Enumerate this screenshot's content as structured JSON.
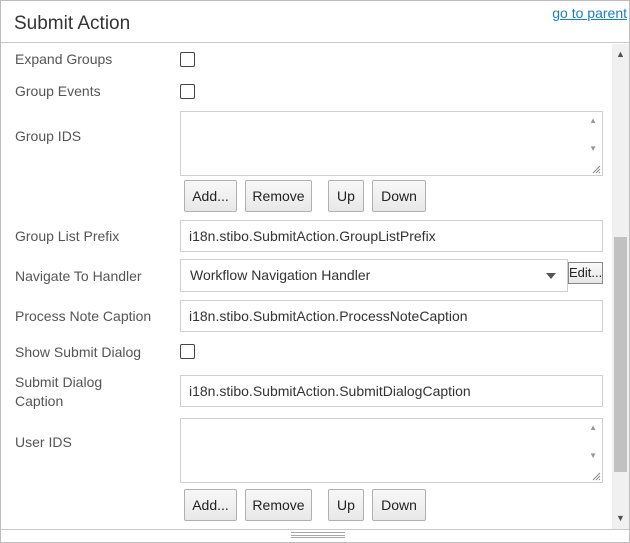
{
  "header": {
    "title": "Submit Action",
    "parent_link": "go to parent"
  },
  "fields": {
    "expand_groups": {
      "label": "Expand Groups",
      "checked": false
    },
    "group_events": {
      "label": "Group Events",
      "checked": false
    },
    "group_ids": {
      "label": "Group IDS",
      "value": ""
    },
    "group_list_prefix": {
      "label": "Group List Prefix",
      "value": "i18n.stibo.SubmitAction.GroupListPrefix"
    },
    "navigate_to_handler": {
      "label": "Navigate To Handler",
      "value": "Workflow Navigation Handler",
      "edit_label": "Edit..."
    },
    "process_note_caption": {
      "label": "Process Note Caption",
      "value": "i18n.stibo.SubmitAction.ProcessNoteCaption"
    },
    "show_submit_dialog": {
      "label": "Show Submit Dialog",
      "checked": false
    },
    "submit_dialog_caption": {
      "label_line1": "Submit Dialog",
      "label_line2": "Caption",
      "value": "i18n.stibo.SubmitAction.SubmitDialogCaption"
    },
    "user_ids": {
      "label": "User IDS",
      "value": ""
    }
  },
  "list_buttons": {
    "add": "Add...",
    "remove": "Remove",
    "up": "Up",
    "down": "Down"
  },
  "icons": {
    "scroll_up": "triangle-up",
    "scroll_down": "triangle-down",
    "resize_grip": "diagonal-lines"
  }
}
